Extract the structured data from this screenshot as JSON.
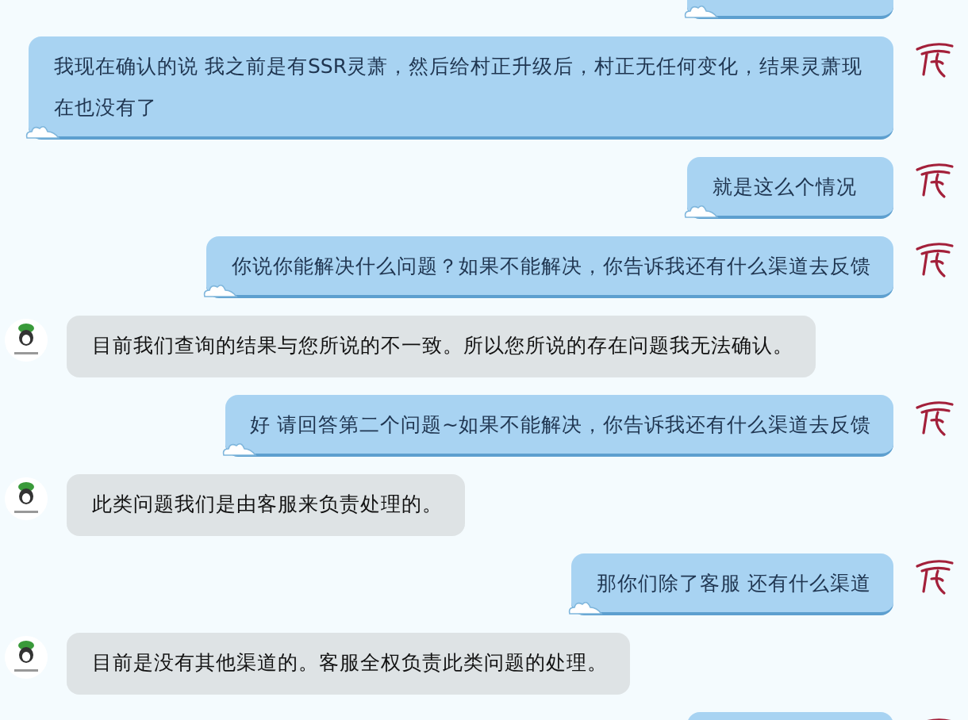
{
  "messages": [
    {
      "kind": "sent"
    },
    {
      "kind": "sent",
      "text": "我现在确认的说 我之前是有SSR灵萧，然后给村正升级后，村正无任何变化，结果灵萧现在也没有了"
    },
    {
      "kind": "sent",
      "text": "就是这么个情况"
    },
    {
      "kind": "sent",
      "text": "你说你能解决什么问题？如果不能解决，你告诉我还有什么渠道去反馈"
    },
    {
      "kind": "received",
      "text": "目前我们查询的结果与您所说的不一致。所以您所说的存在问题我无法确认。"
    },
    {
      "kind": "sent",
      "text": "好 请回答第二个问题~如果不能解决，你告诉我还有什么渠道去反馈"
    },
    {
      "kind": "received",
      "text": "此类问题我们是由客服来负责处理的。"
    },
    {
      "kind": "sent",
      "text": "那你们除了客服 还有什么渠道"
    },
    {
      "kind": "received",
      "text": "目前是没有其他渠道的。客服全权负责此类问题的处理。"
    },
    {
      "kind": "sent"
    }
  ]
}
